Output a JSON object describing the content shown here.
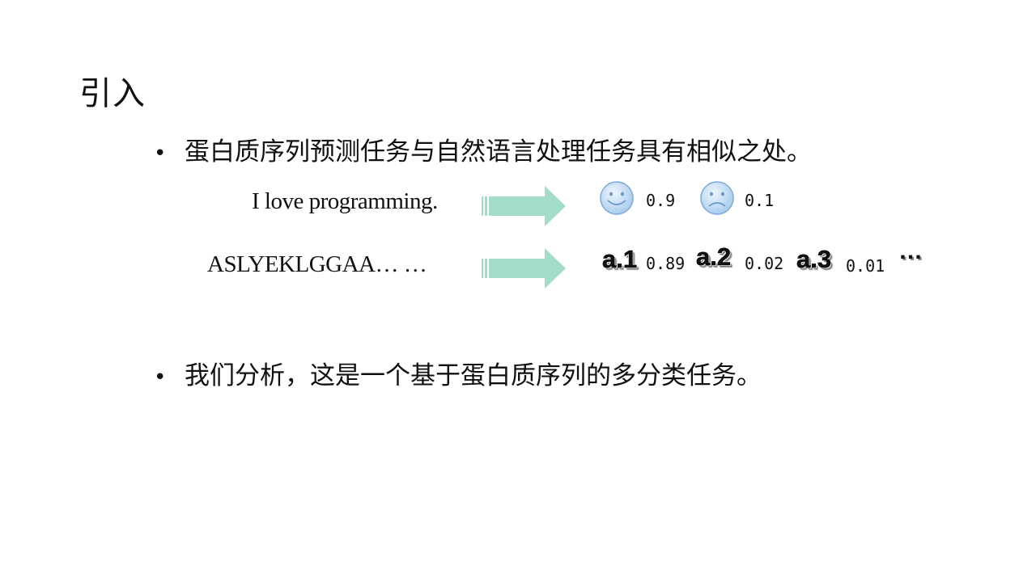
{
  "slide": {
    "title": "引入",
    "bullets": [
      {
        "marker": "•",
        "text": "蛋白质序列预测任务与自然语言处理任务具有相似之处。"
      },
      {
        "marker": "•",
        "text": "我们分析，这是一个基于蛋白质序列的多分类任务。"
      }
    ],
    "example_sentiment": {
      "input": "I love programming.",
      "outputs": [
        {
          "icon": "smiley-face-icon",
          "score": "0.9"
        },
        {
          "icon": "sad-face-icon",
          "score": "0.1"
        }
      ]
    },
    "example_protein": {
      "input": "ASLYEKLGGAA… …",
      "outputs": [
        {
          "label": "a.1",
          "score": "0.89"
        },
        {
          "label": "a.2",
          "score": "0.02"
        },
        {
          "label": "a.3",
          "score": "0.01"
        }
      ],
      "ellipsis": "…"
    },
    "colors": {
      "arrow": "#a3dccb",
      "face_fill": "#cfe4f7",
      "face_stroke": "#7ea9d6"
    }
  }
}
